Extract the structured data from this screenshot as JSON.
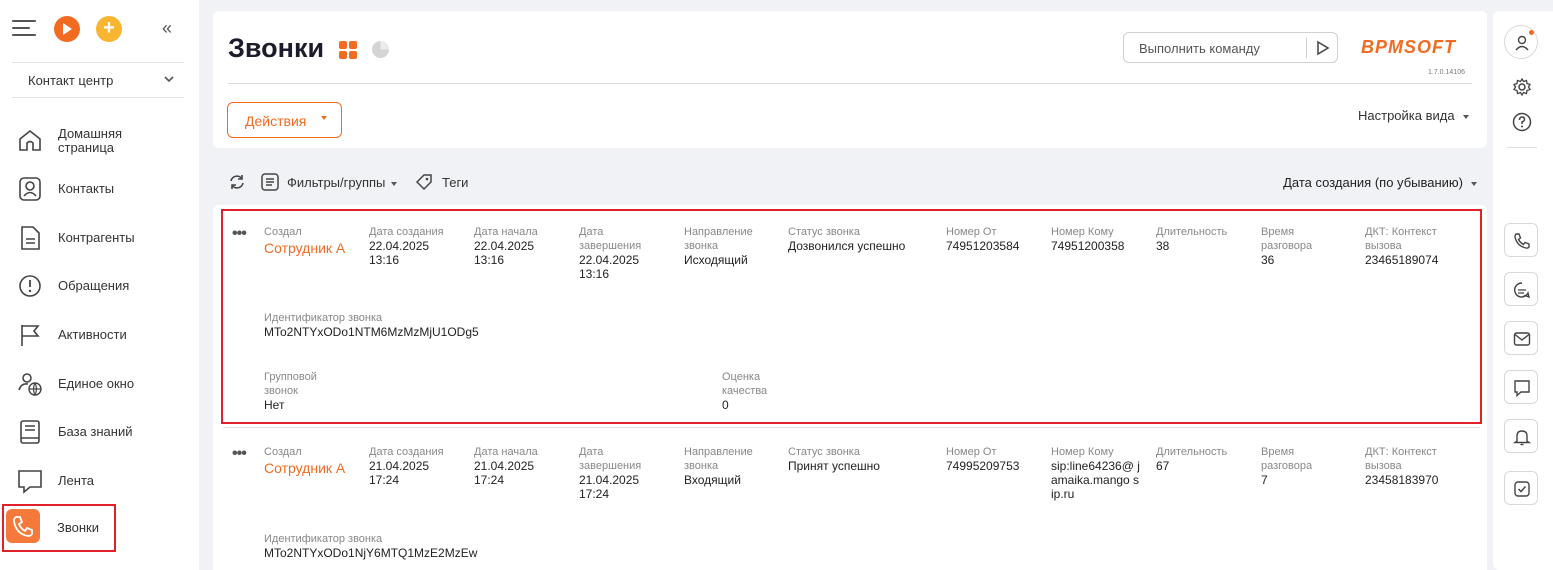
{
  "sidebar": {
    "workspace": "Контакт центр",
    "items": [
      {
        "label": "Домашняя страница",
        "icon": "home-icon"
      },
      {
        "label": "Контакты",
        "icon": "contact-icon"
      },
      {
        "label": "Контрагенты",
        "icon": "document-icon"
      },
      {
        "label": "Обращения",
        "icon": "alert-icon"
      },
      {
        "label": "Активности",
        "icon": "flag-icon"
      },
      {
        "label": "Единое окно",
        "icon": "globe-user-icon"
      },
      {
        "label": "База знаний",
        "icon": "book-icon"
      },
      {
        "label": "Лента",
        "icon": "chat-icon"
      },
      {
        "label": "Звонки",
        "icon": "phone-icon"
      }
    ]
  },
  "header": {
    "title": "Звонки",
    "command_placeholder": "Выполнить команду",
    "logo": "BPMSOFT",
    "version": "1.7.0.14106",
    "actions_label": "Действия",
    "view_setup": "Настройка вида"
  },
  "toolbar": {
    "filters_label": "Фильтры/группы",
    "tags_label": "Теги",
    "sort_label": "Дата создания (по убыванию)"
  },
  "records": [
    {
      "created_by": {
        "cap": "Создал",
        "val": "Сотрудник А"
      },
      "created_on": {
        "cap": "Дата создания",
        "val": "22.04.2025\n13:16"
      },
      "start": {
        "cap": "Дата начала",
        "val": "22.04.2025\n13:16"
      },
      "end": {
        "cap": "Дата завершения",
        "val": "22.04.2025\n13:16"
      },
      "direction": {
        "cap": "Направление звонка",
        "val": "Исходящий"
      },
      "status": {
        "cap": "Статус звонка",
        "val": "Дозвонился успешно"
      },
      "from": {
        "cap": "Номер От",
        "val": "74951203584"
      },
      "to": {
        "cap": "Номер Кому",
        "val": "74951200358"
      },
      "duration": {
        "cap": "Длительность",
        "val": "38"
      },
      "talk_time": {
        "cap": "Время разговора",
        "val": "36"
      },
      "context": {
        "cap": "ДКТ: Контекст вызова",
        "val": "23465189074"
      },
      "call_id": {
        "cap": "Идентификатор звонка",
        "val": "MTo2NTYxODo1NTM6MzMzMjU1ODg5"
      },
      "group_call": {
        "cap": "Групповой звонок",
        "val": "Нет"
      },
      "rating": {
        "cap": "Оценка качества",
        "val": "0"
      }
    },
    {
      "created_by": {
        "cap": "Создал",
        "val": "Сотрудник А"
      },
      "created_on": {
        "cap": "Дата создания",
        "val": "21.04.2025\n17:24"
      },
      "start": {
        "cap": "Дата начала",
        "val": "21.04.2025\n17:24"
      },
      "end": {
        "cap": "Дата завершения",
        "val": "21.04.2025\n17:24"
      },
      "direction": {
        "cap": "Направление звонка",
        "val": "Входящий"
      },
      "status": {
        "cap": "Статус звонка",
        "val": "Принят успешно"
      },
      "from": {
        "cap": "Номер От",
        "val": "74995209753"
      },
      "to": {
        "cap": "Номер Кому",
        "val": "sip:line64236@ jamaika.mango sip.ru"
      },
      "duration": {
        "cap": "Длительность",
        "val": "67"
      },
      "talk_time": {
        "cap": "Время разговора",
        "val": "7"
      },
      "context": {
        "cap": "ДКТ: Контекст вызова",
        "val": "23458183970"
      },
      "call_id": {
        "cap": "Идентификатор звонка",
        "val": "MTo2NTYxODo1NjY6MTQ1MzE2MzEw"
      }
    }
  ],
  "colors": {
    "accent": "#f26b21",
    "highlight": "#e0202a"
  }
}
